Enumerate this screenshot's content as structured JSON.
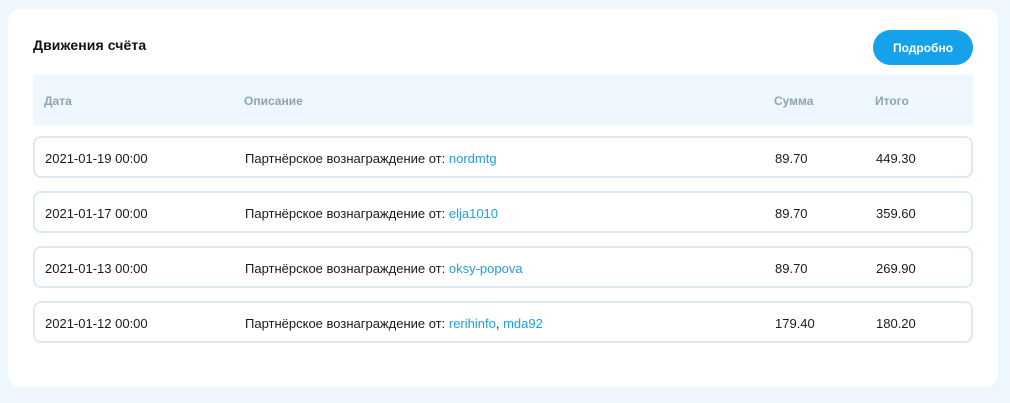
{
  "card": {
    "title": "Движения счёта",
    "details_label": "Подробно"
  },
  "table": {
    "headers": {
      "date": "Дата",
      "description": "Описание",
      "sum": "Сумма",
      "total": "Итого"
    },
    "description_prefix": "Партнёрское вознаграждение от: ",
    "rows": [
      {
        "date": "2021-01-19 00:00",
        "users": [
          "nordmtg"
        ],
        "sum": "89.70",
        "total": "449.30"
      },
      {
        "date": "2021-01-17 00:00",
        "users": [
          "elja1010"
        ],
        "sum": "89.70",
        "total": "359.60"
      },
      {
        "date": "2021-01-13 00:00",
        "users": [
          "oksy-popova"
        ],
        "sum": "89.70",
        "total": "269.90"
      },
      {
        "date": "2021-01-12 00:00",
        "users": [
          "rerihinfo",
          "mda92"
        ],
        "sum": "179.40",
        "total": "180.20"
      }
    ]
  },
  "colors": {
    "page_background": "#eef7fd",
    "card_background": "#ffffff",
    "accent": "#16a2ea",
    "link": "#1f9ee2",
    "header_text": "#8ca4b3",
    "row_border": "#dde9f2"
  }
}
